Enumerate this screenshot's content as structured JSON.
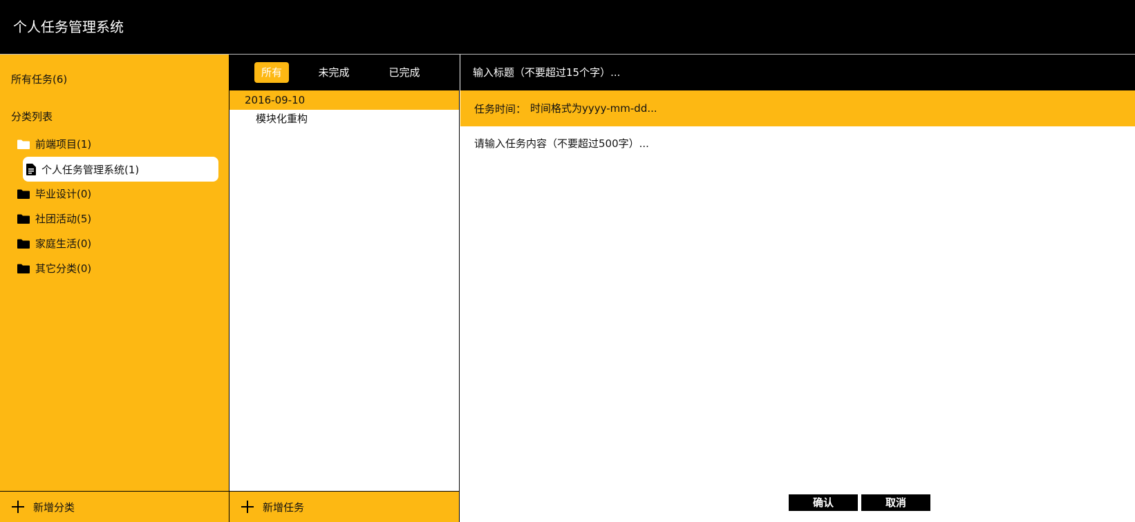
{
  "header": {
    "title": "个人任务管理系统"
  },
  "sidebar": {
    "all_tasks": "所有任务(6)",
    "category_heading": "分类列表",
    "categories": [
      {
        "label": "前端项目(1)",
        "icon": "folder-open-icon",
        "children": [
          {
            "label": "个人任务管理系统(1)",
            "icon": "document-icon",
            "selected": true
          }
        ]
      },
      {
        "label": "毕业设计(0)",
        "icon": "folder-icon"
      },
      {
        "label": "社团活动(5)",
        "icon": "folder-icon"
      },
      {
        "label": "家庭生活(0)",
        "icon": "folder-icon"
      },
      {
        "label": "其它分类(0)",
        "icon": "folder-icon"
      }
    ],
    "add_category": "新增分类"
  },
  "task_list": {
    "tabs": [
      {
        "label": "所有",
        "active": true
      },
      {
        "label": "未完成",
        "active": false
      },
      {
        "label": "已完成",
        "active": false
      }
    ],
    "groups": [
      {
        "date": "2016-09-10",
        "tasks": [
          "模块化重构"
        ]
      }
    ],
    "add_task": "新增任务"
  },
  "editor": {
    "title_placeholder": "输入标题（不要超过15个字）...",
    "time_label": "任务时间：",
    "time_placeholder": "时间格式为yyyy-mm-dd...",
    "content_placeholder": "请输入任务内容（不要超过500字）...",
    "confirm": "确认",
    "cancel": "取消"
  },
  "colors": {
    "accent": "#FDB813",
    "header": "#000000",
    "panel": "#FFFFFF"
  }
}
